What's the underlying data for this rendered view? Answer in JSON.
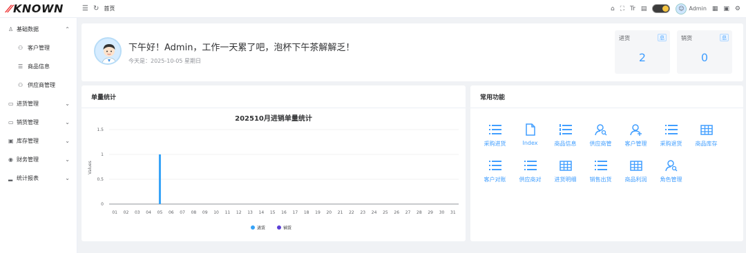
{
  "brand": {
    "name": "KNOWN",
    "accent": "#e33333"
  },
  "topbar": {
    "crumb": "首页",
    "icons_left": [
      "menu-fold-icon",
      "refresh-icon"
    ],
    "icons_right": [
      "home-icon",
      "fullscreen-icon",
      "font-size-icon",
      "layout-icon",
      "theme-toggle",
      "user-avatar",
      "message-icon",
      "grid-icon",
      "settings-icon"
    ],
    "username": "Admin"
  },
  "sidebar": {
    "items": [
      {
        "label": "基础数据",
        "icon": "user-icon",
        "expanded": true,
        "children": [
          {
            "label": "客户管理",
            "icon": "users-icon"
          },
          {
            "label": "商品信息",
            "icon": "list-icon"
          },
          {
            "label": "供应商管理",
            "icon": "users-icon"
          }
        ]
      },
      {
        "label": "进货管理",
        "icon": "inbox-icon",
        "expanded": false
      },
      {
        "label": "销货管理",
        "icon": "outbox-icon",
        "expanded": false
      },
      {
        "label": "库存管理",
        "icon": "box-icon",
        "expanded": false
      },
      {
        "label": "财务管理",
        "icon": "money-icon",
        "expanded": false
      },
      {
        "label": "统计报表",
        "icon": "chart-icon",
        "expanded": false
      }
    ]
  },
  "welcome": {
    "greeting": "下午好！Admin，工作一天累了吧，泡杯下午茶解解乏！",
    "date": "今天是：2025-10-05 星期日"
  },
  "stats": [
    {
      "title": "进货",
      "tag": "总",
      "value": "2"
    },
    {
      "title": "销货",
      "tag": "总",
      "value": "0"
    }
  ],
  "chart_card": {
    "title": "单量统计"
  },
  "chart_data": {
    "type": "bar",
    "title": "202510月进销单量统计",
    "ylabel": "Values",
    "ylim": [
      0,
      1.5
    ],
    "yticks": [
      "0",
      "0.5",
      "1",
      "1.5"
    ],
    "categories": [
      "01",
      "02",
      "03",
      "04",
      "05",
      "06",
      "07",
      "08",
      "09",
      "10",
      "11",
      "12",
      "13",
      "14",
      "15",
      "16",
      "17",
      "18",
      "19",
      "20",
      "21",
      "22",
      "23",
      "24",
      "25",
      "26",
      "27",
      "28",
      "29",
      "30",
      "31"
    ],
    "series": [
      {
        "name": "进货",
        "color": "#36a3f7",
        "values": [
          0,
          0,
          0,
          0,
          1,
          0,
          0,
          0,
          0,
          0,
          0,
          0,
          0,
          0,
          0,
          0,
          0,
          0,
          0,
          0,
          0,
          0,
          0,
          0,
          0,
          0,
          0,
          0,
          0,
          0,
          0
        ]
      },
      {
        "name": "销货",
        "color": "#5b3fd6",
        "values": [
          0,
          0,
          0,
          0,
          0,
          0,
          0,
          0,
          0,
          0,
          0,
          0,
          0,
          0,
          0,
          0,
          0,
          0,
          0,
          0,
          0,
          0,
          0,
          0,
          0,
          0,
          0,
          0,
          0,
          0,
          0
        ]
      }
    ],
    "legend": "bottom-center"
  },
  "functions": {
    "title": "常用功能",
    "items": [
      {
        "label": "采购进货",
        "icon": "list-icon"
      },
      {
        "label": "Index",
        "icon": "file-icon"
      },
      {
        "label": "商品信息",
        "icon": "ordered-list-icon"
      },
      {
        "label": "供应商管",
        "icon": "user-search-icon"
      },
      {
        "label": "客户管理",
        "icon": "user-add-icon"
      },
      {
        "label": "采购退货",
        "icon": "list-icon"
      },
      {
        "label": "商品库存",
        "icon": "table-icon"
      },
      {
        "label": "客户对账",
        "icon": "list-icon"
      },
      {
        "label": "供应商对",
        "icon": "list-icon"
      },
      {
        "label": "进货明细",
        "icon": "table-icon"
      },
      {
        "label": "销售出货",
        "icon": "list-icon"
      },
      {
        "label": "商品利润",
        "icon": "table-icon"
      },
      {
        "label": "角色管理",
        "icon": "user-search-icon"
      }
    ]
  },
  "colors": {
    "primary": "#409eff",
    "background": "#f0f2f5"
  }
}
